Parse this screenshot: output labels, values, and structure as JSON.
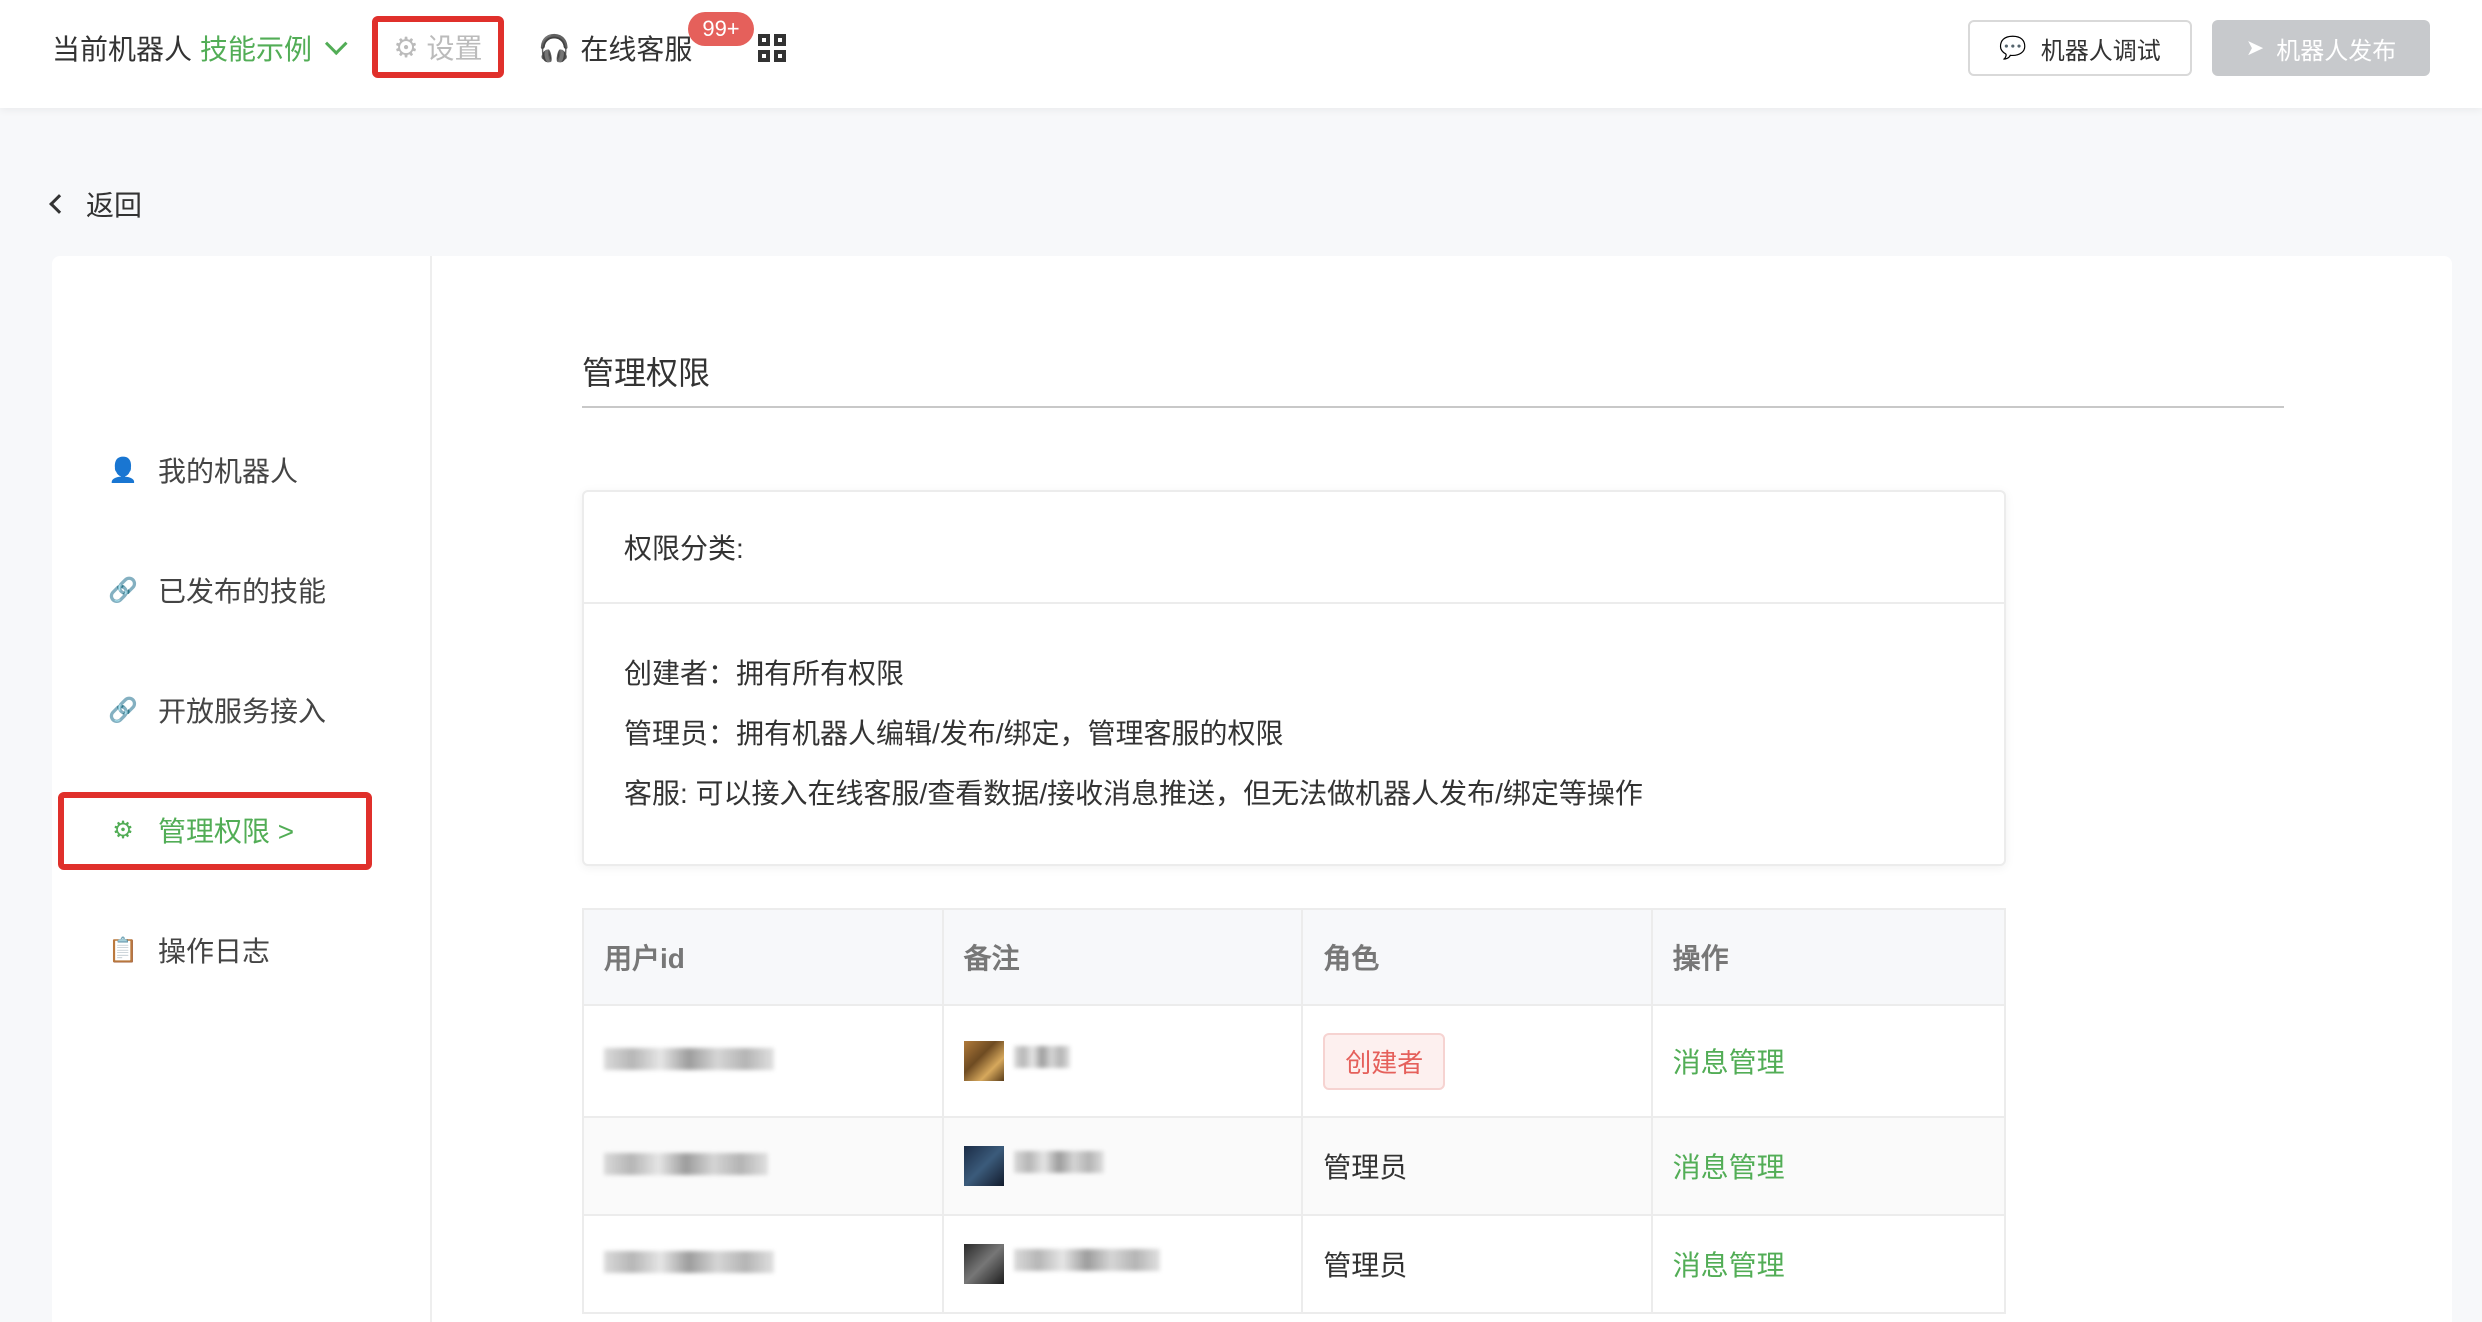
{
  "topbar": {
    "current_label": "当前机器人",
    "current_skill": "技能示例",
    "settings_label": "设置",
    "service_label": "在线客服",
    "service_badge": "99+",
    "debug_button": "机器人调试",
    "publish_button": "机器人发布"
  },
  "back": {
    "label": "返回"
  },
  "sidebar": {
    "items": [
      {
        "label": "我的机器人",
        "icon": "user-icon"
      },
      {
        "label": "已发布的技能",
        "icon": "link-icon"
      },
      {
        "label": "开放服务接入",
        "icon": "link-icon"
      },
      {
        "label": "管理权限 >",
        "icon": "gear-icon",
        "active": true
      },
      {
        "label": "操作日志",
        "icon": "clipboard-icon"
      }
    ]
  },
  "content": {
    "title": "管理权限",
    "perm": {
      "heading": "权限分类:",
      "lines": [
        "创建者：拥有所有权限",
        "管理员：拥有机器人编辑/发布/绑定，管理客服的权限",
        "客服: 可以接入在线客服/查看数据/接收消息推送，但无法做机器人发布/绑定等操作"
      ]
    },
    "table": {
      "headers": [
        "用户id",
        "备注",
        "角色",
        "操作"
      ],
      "rows": [
        {
          "role": "创建者",
          "action": "消息管理"
        },
        {
          "role": "管理员",
          "action": "消息管理"
        },
        {
          "role": "管理员",
          "action": "消息管理"
        }
      ]
    }
  },
  "colors": {
    "accent": "#52ad56",
    "highlight": "#e0302b",
    "badge": "#e5605b"
  }
}
